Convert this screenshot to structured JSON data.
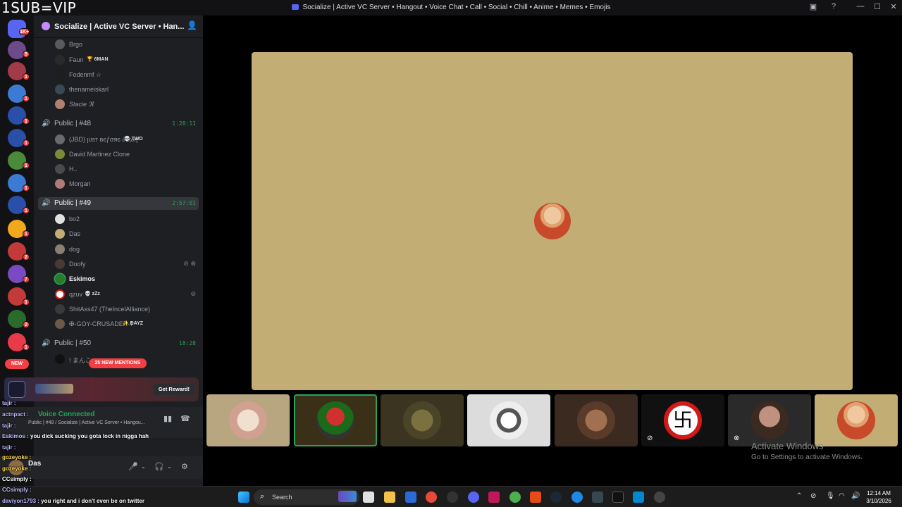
{
  "overlay_banner": "1SUB=VIP",
  "window": {
    "title": "Socialize | Active VC Server • Hangout • Voice Chat • Call • Social • Chill • Anime • Memes • Emojis",
    "controls": [
      "—",
      "☐",
      "✕"
    ]
  },
  "rail": {
    "home_badge": "1K+",
    "badges": [
      "5",
      "1",
      "1",
      "1",
      "1",
      "1",
      "1",
      "1",
      "1",
      "2",
      "7",
      "1",
      "2",
      "1"
    ],
    "new_label": "NEW"
  },
  "server": {
    "name": "Socialize | Active VC Server • Han...",
    "accent": "#c68bff"
  },
  "channels": [
    {
      "name": "",
      "users": [
        {
          "name": "Brgo"
        },
        {
          "name": "Faun",
          "tag": "🏆 6MAN"
        },
        {
          "name": "Fodenmf ☆"
        },
        {
          "name": "thenameiskarl"
        },
        {
          "name": "Stacie ℜ"
        }
      ]
    },
    {
      "name": "Public | #48",
      "timer": "1:28:11",
      "users": [
        {
          "name": "(JBD) ȷυsт вєƒσяє ∂αωη",
          "tag": "💀 TWD"
        },
        {
          "name": "David Martinez Clone"
        },
        {
          "name": "H.."
        },
        {
          "name": "Morgan"
        }
      ]
    },
    {
      "name": "Public | #49",
      "timer": "2:57:01",
      "selected": true,
      "users": [
        {
          "name": "bo2"
        },
        {
          "name": "Das"
        },
        {
          "name": "dog"
        },
        {
          "name": "Doofy",
          "state": "⊘ ⊗"
        },
        {
          "name": "Eskimos",
          "active": true
        },
        {
          "name": "qzuv",
          "tag": "💀 zZz",
          "state": "⊘"
        },
        {
          "name": "ShitAss47 (TheIncelAlliance)"
        },
        {
          "name": "✠-GOY-CRUSADER-☨",
          "tag": "✨ DAYZ"
        }
      ]
    },
    {
      "name": "Public | #50",
      "timer": "18:28",
      "users": [
        {
          "name": "! まんこ"
        }
      ]
    }
  ],
  "mentions_pill": "25 NEW MENTIONS",
  "promo": {
    "button": "Get Reward!"
  },
  "voice_panel": {
    "status": "Voice Connected",
    "channel": "Public | #49 / Socialize | Active VC Server • Hangou..."
  },
  "user_panel": {
    "username": "Das"
  },
  "chat_overlay": [
    {
      "user": "tajir :",
      "msg": "",
      "style": ""
    },
    {
      "user": "actnpact :",
      "msg": "",
      "style": ""
    },
    {
      "user": "tajir :",
      "msg": "",
      "style": ""
    },
    {
      "user": "Eskimos :",
      "msg": "you dick sucking you gota lock in nigga hah",
      "style": ""
    },
    {
      "user": "tajir :",
      "msg": "",
      "style": ""
    },
    {
      "user": "gozeyoke :",
      "msg": "",
      "style": "y"
    },
    {
      "user": "gozeyoke :",
      "msg": "",
      "style": "y"
    },
    {
      "user": "CCsimply :",
      "msg": "",
      "style": ""
    },
    {
      "user": "CCsimply :",
      "msg": "",
      "style": ""
    },
    {
      "user": "daviyon1793 :",
      "msg": "you right and i don't even be on twitter",
      "style": ""
    }
  ],
  "activate_windows": {
    "heading": "Activate Windows",
    "sub": "Go to Settings to activate Windows."
  },
  "taskbar": {
    "search_placeholder": "Search",
    "time": "12:14 AM",
    "date": "3/10/2026"
  }
}
